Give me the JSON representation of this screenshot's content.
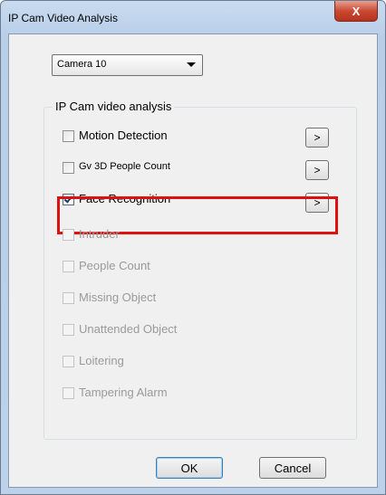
{
  "window": {
    "title": "IP Cam Video Analysis",
    "close_glyph": "X"
  },
  "camera_select": {
    "value": "Camera 10"
  },
  "group": {
    "title": "IP Cam video analysis"
  },
  "items": [
    {
      "label": "Motion Detection",
      "checked": false,
      "enabled": true,
      "has_settings": true
    },
    {
      "label": "Gv 3D People Count",
      "checked": false,
      "enabled": true,
      "has_settings": true
    },
    {
      "label": "Face Recognition",
      "checked": true,
      "enabled": true,
      "has_settings": true
    },
    {
      "label": "Intruder",
      "checked": false,
      "enabled": false
    },
    {
      "label": "People Count",
      "checked": false,
      "enabled": false
    },
    {
      "label": "Missing Object",
      "checked": false,
      "enabled": false
    },
    {
      "label": "Unattended Object",
      "checked": false,
      "enabled": false
    },
    {
      "label": "Loitering",
      "checked": false,
      "enabled": false
    },
    {
      "label": "Tampering Alarm",
      "checked": false,
      "enabled": false
    }
  ],
  "settings_button_label": ">",
  "buttons": {
    "ok": "OK",
    "cancel": "Cancel"
  },
  "colors": {
    "highlight": "#e01010",
    "close_button": "#c94a33"
  }
}
